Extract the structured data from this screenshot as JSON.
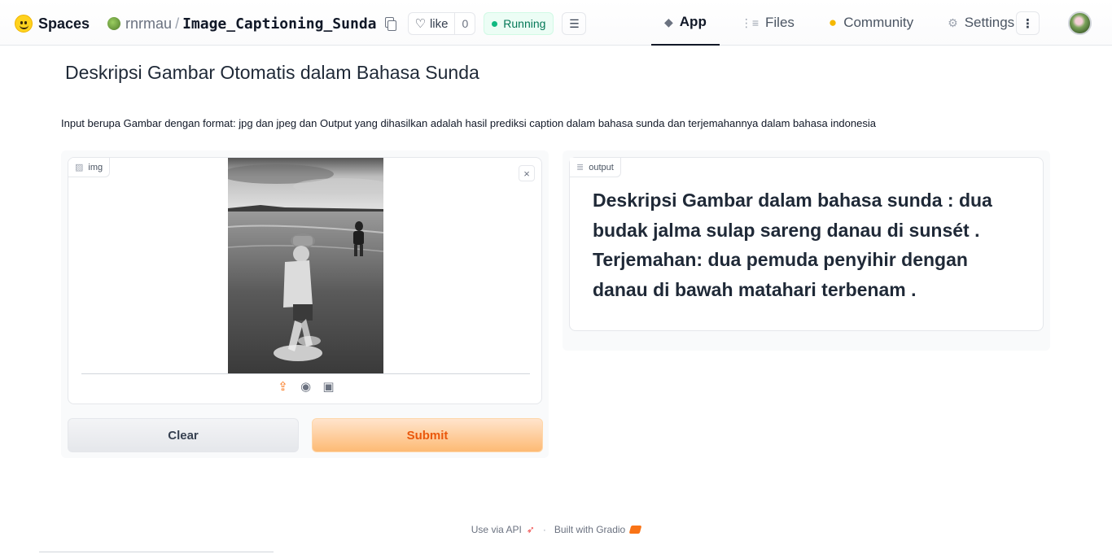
{
  "nav": {
    "spaces_label": "Spaces",
    "user": "rnrmau",
    "separator": "/",
    "repo": "Image_Captioning_Sunda",
    "like_label": "like",
    "like_count": "0",
    "status": "Running",
    "tabs": [
      {
        "label": "App",
        "icon": "cube-icon",
        "active": true
      },
      {
        "label": "Files",
        "icon": "files-icon",
        "active": false
      },
      {
        "label": "Community",
        "icon": "community-icon",
        "active": false
      },
      {
        "label": "Settings",
        "icon": "gear-icon",
        "active": false
      }
    ]
  },
  "app": {
    "title": "Deskripsi Gambar Otomatis dalam Bahasa Sunda",
    "description": "Input berupa Gambar dengan format: jpg dan jpeg dan Output yang dihasilkan adalah hasil prediksi caption dalam bahasa sunda dan terjemahannya dalam bahasa indonesia"
  },
  "input": {
    "label": "img"
  },
  "buttons": {
    "clear": "Clear",
    "submit": "Submit"
  },
  "output": {
    "label": "output",
    "text": "Deskripsi Gambar dalam bahasa sunda : dua budak jalma sulap sareng danau di sunsét . Terjemahan: dua pemuda penyihir dengan danau di bawah matahari terbenam ."
  },
  "footer": {
    "api": "Use via API",
    "dot": "·",
    "built": "Built with Gradio"
  },
  "colors": {
    "accent": "#f97316",
    "running": "#10b981"
  }
}
